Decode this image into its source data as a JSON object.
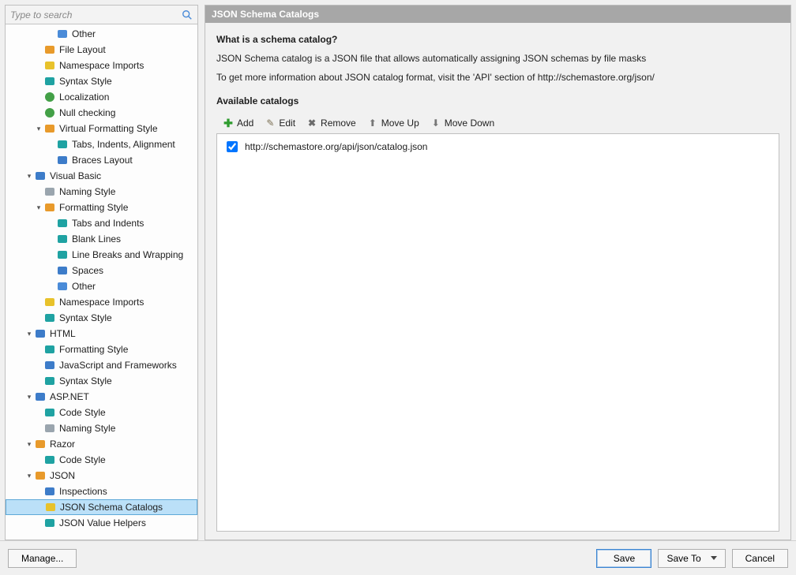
{
  "search": {
    "placeholder": "Type to search"
  },
  "header": {
    "title": "JSON Schema Catalogs"
  },
  "content": {
    "q_heading": "What is a schema catalog?",
    "desc_1": "JSON Schema catalog is a JSON file that allows automatically assigning JSON schemas by file masks",
    "desc_2": "To get more information about JSON catalog format, visit the 'API' section of http://schemastore.org/json/",
    "available_heading": "Available catalogs"
  },
  "toolbar": {
    "add": "Add",
    "edit": "Edit",
    "remove": "Remove",
    "move_up": "Move Up",
    "move_down": "Move Down"
  },
  "catalogs": {
    "item0": {
      "label": "http://schemastore.org/api/json/catalog.json",
      "checked": true
    }
  },
  "buttons": {
    "manage": "Manage...",
    "save": "Save",
    "save_to": "Save To",
    "cancel": "Cancel"
  },
  "tree": {
    "n0": "Other",
    "n1": "File Layout",
    "n2": "Namespace Imports",
    "n3": "Syntax Style",
    "n4": "Localization",
    "n5": "Null checking",
    "n6": "Virtual Formatting Style",
    "n7": "Tabs, Indents, Alignment",
    "n8": "Braces Layout",
    "n9": "Visual Basic",
    "n10": "Naming Style",
    "n11": "Formatting Style",
    "n12": "Tabs and Indents",
    "n13": "Blank Lines",
    "n14": "Line Breaks and Wrapping",
    "n15": "Spaces",
    "n16": "Other",
    "n17": "Namespace Imports",
    "n18": "Syntax Style",
    "n19": "HTML",
    "n20": "Formatting Style",
    "n21": "JavaScript and Frameworks",
    "n22": "Syntax Style",
    "n23": "ASP.NET",
    "n24": "Code Style",
    "n25": "Naming Style",
    "n26": "Razor",
    "n27": "Code Style",
    "n28": "JSON",
    "n29": "Inspections",
    "n30": "JSON Schema Catalogs",
    "n31": "JSON Value Helpers"
  }
}
